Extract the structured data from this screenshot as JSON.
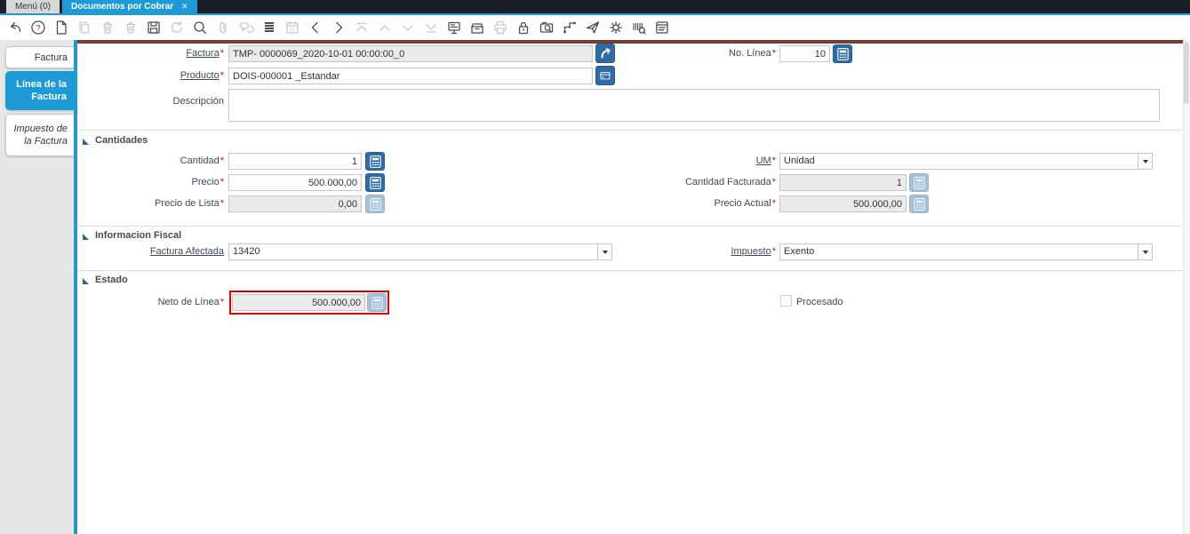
{
  "topbar": {
    "menu_tab": "Menú (0)",
    "doc_tab": "Documentos por Cobrar",
    "close_glyph": "✕"
  },
  "toolbar": {
    "items": [
      {
        "icon": "undo-icon",
        "enabled": true
      },
      {
        "icon": "help-icon",
        "enabled": true
      },
      {
        "icon": "new-record-icon",
        "enabled": true
      },
      {
        "icon": "copy-record-icon",
        "enabled": false
      },
      {
        "icon": "delete-record-icon",
        "enabled": false
      },
      {
        "icon": "delete-selection-icon",
        "enabled": false
      },
      {
        "icon": "save-icon",
        "enabled": true
      },
      {
        "icon": "refresh-icon",
        "enabled": false
      },
      {
        "icon": "find-icon",
        "enabled": true
      },
      {
        "icon": "attachment-icon",
        "enabled": false
      },
      {
        "icon": "chat-icon",
        "enabled": false
      },
      {
        "icon": "grid-toggle-icon",
        "enabled": true
      },
      {
        "icon": "calendar-icon",
        "enabled": false
      },
      {
        "icon": "previous-icon",
        "enabled": true
      },
      {
        "icon": "next-icon",
        "enabled": true
      },
      {
        "icon": "first-record-icon",
        "enabled": false
      },
      {
        "icon": "previous-record-icon",
        "enabled": false
      },
      {
        "icon": "next-record-icon",
        "enabled": false
      },
      {
        "icon": "last-record-icon",
        "enabled": false
      },
      {
        "icon": "detail-view-icon",
        "enabled": true
      },
      {
        "icon": "archive-icon",
        "enabled": true
      },
      {
        "icon": "print-icon",
        "enabled": false
      },
      {
        "icon": "lock-icon",
        "enabled": true
      },
      {
        "icon": "zoom-across-icon",
        "enabled": true
      },
      {
        "icon": "workflow-icon",
        "enabled": true
      },
      {
        "icon": "request-icon",
        "enabled": true
      },
      {
        "icon": "preferences-icon",
        "enabled": true
      },
      {
        "icon": "product-info-icon",
        "enabled": true
      },
      {
        "icon": "report-icon",
        "enabled": true
      }
    ]
  },
  "sidebar": {
    "tab_factura": "Factura",
    "tab_linea": "Línea de la Factura",
    "tab_impuesto": "Impuesto de la Factura"
  },
  "form": {
    "req": "*",
    "factura_label": "Factura",
    "factura_value": "TMP- 0000069_2020-10-01 00:00:00_0",
    "no_linea_label": "No. Línea",
    "no_linea_value": "10",
    "producto_label": "Producto",
    "producto_value": "DOIS-000001 _Estandar",
    "descripcion_label": "Descripción",
    "descripcion_value": "",
    "sec_cantidades": "Cantidades",
    "cantidad_label": "Cantidad",
    "cantidad_value": "1",
    "um_label": "UM",
    "um_value": "Unidad",
    "precio_label": "Precio",
    "precio_value": "500.000,00",
    "cantidad_facturada_label": "Cantidad Facturada",
    "cantidad_facturada_value": "1",
    "precio_lista_label": "Precio de Lista",
    "precio_lista_value": "0,00",
    "precio_actual_label": "Precio Actual",
    "precio_actual_value": "500.000,00",
    "sec_fiscal": "Informacion Fiscal",
    "factura_afectada_label": "Factura Afectada",
    "factura_afectada_value": "13420",
    "impuesto_label": "Impuesto",
    "impuesto_value": "Exento",
    "sec_estado": "Estado",
    "neto_label": "Neto de Línea",
    "neto_value": "500.000,00",
    "procesado_label": "Procesado"
  },
  "colors": {
    "accent_blue": "#1e9bd7",
    "button_blue": "#2d6da3",
    "button_blue_disabled": "#a6c0da",
    "topbar_dark": "#1a1f27",
    "maroon_strip": "#7d3a35",
    "required_red": "#e30000",
    "highlight_border_red": "#e20000",
    "sidebar_grey": "#e7e7e7",
    "readonly_grey": "#ebebeb"
  }
}
